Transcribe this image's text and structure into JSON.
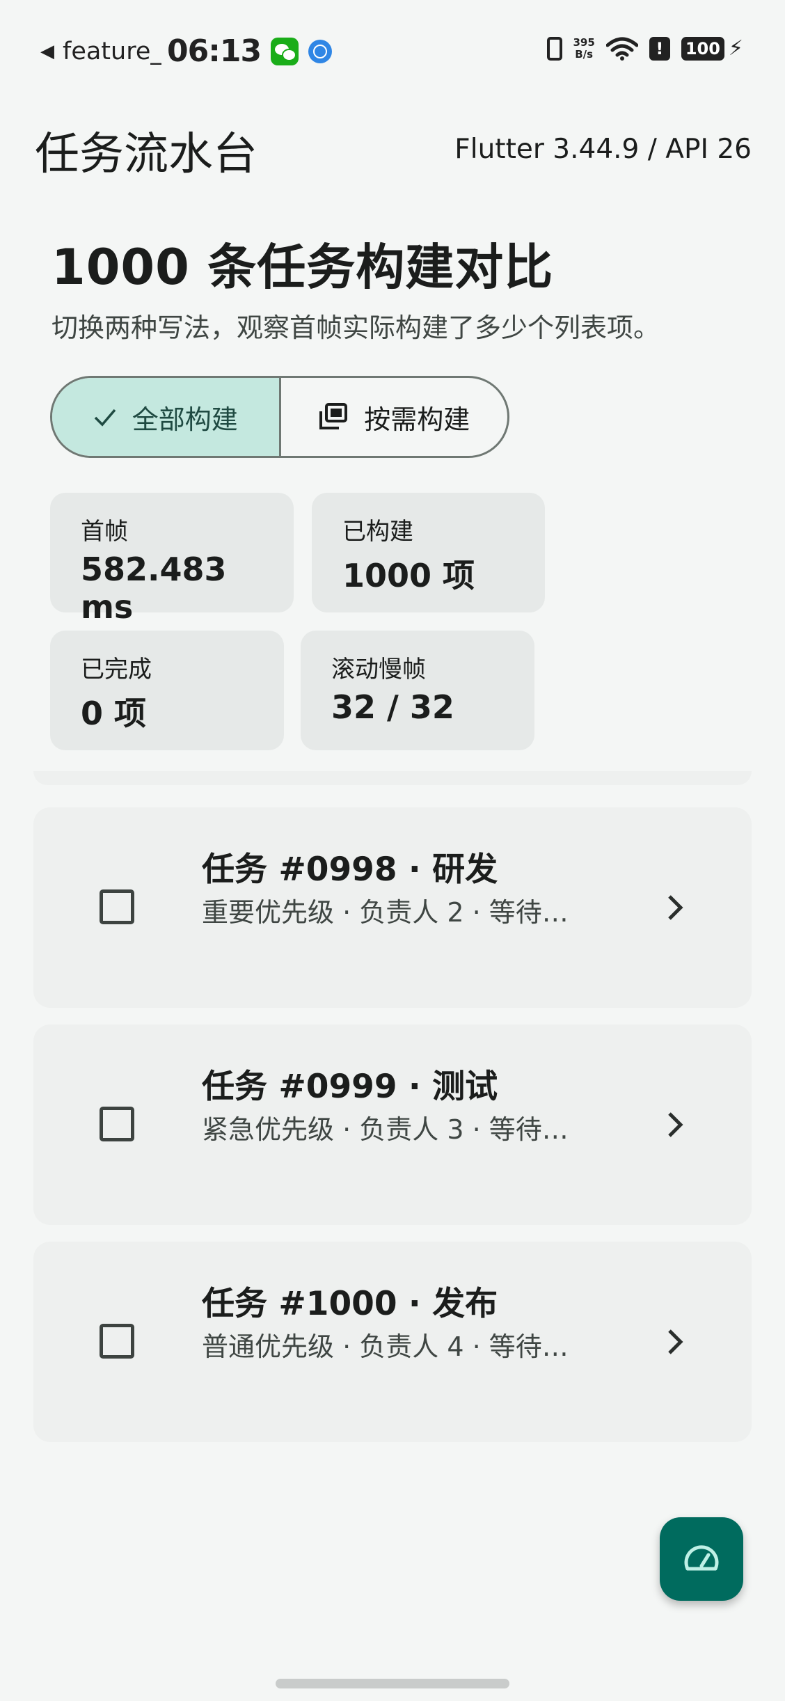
{
  "status_bar": {
    "back_glyph": "◀",
    "app_name": "feature_",
    "time": "06:13",
    "net_speed_value": "395",
    "net_speed_unit": "B/s",
    "alert": "!",
    "battery": "100",
    "icons": [
      "wechat-icon",
      "globe-icon",
      "vibrate-icon",
      "wifi-icon",
      "alert-icon",
      "battery-icon",
      "charging-icon"
    ]
  },
  "app_bar": {
    "title": "任务流水台",
    "version": "Flutter 3.44.9 / API 26"
  },
  "hero": {
    "title": "1000 条任务构建对比",
    "subtitle": "切换两种写法，观察首帧实际构建了多少个列表项。"
  },
  "segmented": {
    "options": [
      {
        "label": "全部构建",
        "selected": true,
        "icon": "check-icon"
      },
      {
        "label": "按需构建",
        "selected": false,
        "icon": "copy-icon"
      }
    ]
  },
  "stats": [
    {
      "label": "首帧",
      "value": "582.483 ms"
    },
    {
      "label": "已构建",
      "value": "1000 项"
    },
    {
      "label": "已完成",
      "value": "0 项"
    },
    {
      "label": "滚动慢帧",
      "value": "32 / 32"
    }
  ],
  "tasks": [
    {
      "title": "任务 #0998 · 研发",
      "meta": "重要优先级 · 负责人 2 · 等待…",
      "checked": false
    },
    {
      "title": "任务 #0999 · 测试",
      "meta": "紧急优先级 · 负责人 3 · 等待…",
      "checked": false
    },
    {
      "title": "任务 #1000 · 发布",
      "meta": "普通优先级 · 负责人 4 · 等待…",
      "checked": false
    }
  ],
  "fab": {
    "icon": "speedometer-icon"
  },
  "colors": {
    "background": "#f4f6f5",
    "selected_segment": "#c4e8df",
    "stat_card": "#e6e9e8",
    "task_card": "#eef0ef",
    "fab": "#006b5e"
  }
}
